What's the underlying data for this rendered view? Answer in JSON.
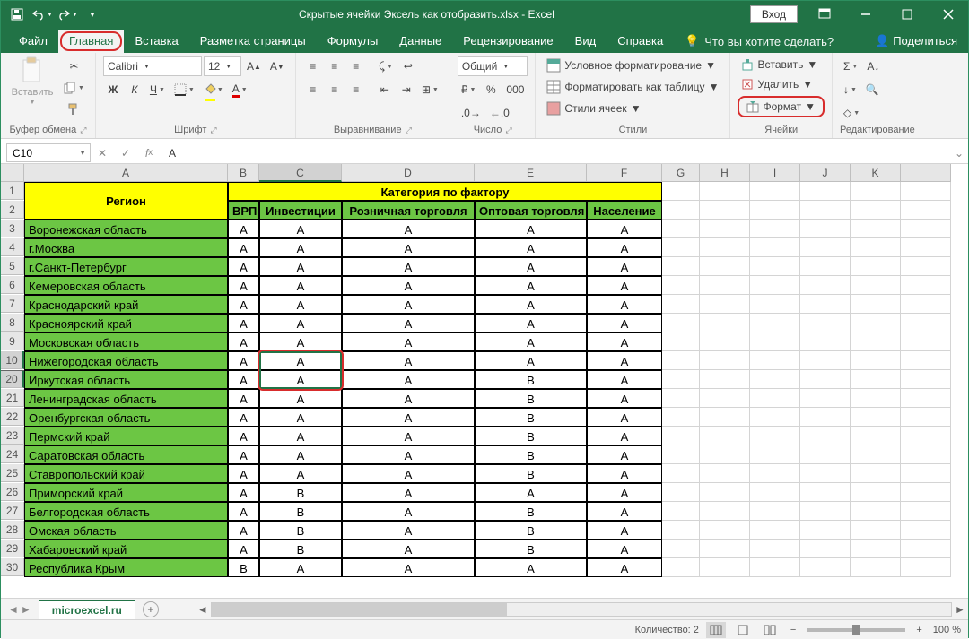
{
  "titlebar": {
    "title": "Скрытые ячейки Эксель как отобразить.xlsx  -  Excel",
    "signin": "Вход"
  },
  "tabs": [
    "Файл",
    "Главная",
    "Вставка",
    "Разметка страницы",
    "Формулы",
    "Данные",
    "Рецензирование",
    "Вид",
    "Справка"
  ],
  "active_tab": 1,
  "tell_me": "Что вы хотите сделать?",
  "share": "Поделиться",
  "ribbon": {
    "clipboard": {
      "paste": "Вставить",
      "label": "Буфер обмена"
    },
    "font": {
      "name": "Calibri",
      "size": "12",
      "label": "Шрифт"
    },
    "alignment": {
      "label": "Выравнивание"
    },
    "number": {
      "format": "Общий",
      "label": "Число"
    },
    "styles": {
      "cond": "Условное форматирование",
      "table": "Форматировать как таблицу",
      "cell": "Стили ячеек",
      "label": "Стили"
    },
    "cells": {
      "insert": "Вставить",
      "delete": "Удалить",
      "format": "Формат",
      "label": "Ячейки"
    },
    "editing": {
      "label": "Редактирование"
    }
  },
  "formula": {
    "name_box": "C10",
    "value": "А"
  },
  "columns": [
    "A",
    "B",
    "C",
    "D",
    "E",
    "F",
    "G",
    "H",
    "I",
    "J",
    "K"
  ],
  "header1": {
    "region": "Регион",
    "category": "Категория по фактору"
  },
  "header2": [
    "ВРП",
    "Инвестиции",
    "Розничная торговля",
    "Оптовая торговля",
    "Население"
  ],
  "rows": [
    {
      "n": 3,
      "region": "Воронежская область",
      "v": [
        "А",
        "А",
        "А",
        "А",
        "А"
      ]
    },
    {
      "n": 4,
      "region": "г.Москва",
      "v": [
        "А",
        "А",
        "А",
        "А",
        "А"
      ]
    },
    {
      "n": 5,
      "region": "г.Санкт-Петербург",
      "v": [
        "А",
        "А",
        "А",
        "А",
        "А"
      ]
    },
    {
      "n": 6,
      "region": "Кемеровская область",
      "v": [
        "А",
        "А",
        "А",
        "А",
        "А"
      ]
    },
    {
      "n": 7,
      "region": "Краснодарский край",
      "v": [
        "А",
        "А",
        "А",
        "А",
        "А"
      ]
    },
    {
      "n": 8,
      "region": "Красноярский край",
      "v": [
        "А",
        "А",
        "А",
        "А",
        "А"
      ]
    },
    {
      "n": 9,
      "region": "Московская область",
      "v": [
        "А",
        "А",
        "А",
        "А",
        "А"
      ]
    },
    {
      "n": 10,
      "region": "Нижегородская область",
      "v": [
        "А",
        "А",
        "А",
        "А",
        "А"
      ]
    },
    {
      "n": 20,
      "region": "Иркутская область",
      "v": [
        "А",
        "А",
        "А",
        "В",
        "А"
      ]
    },
    {
      "n": 21,
      "region": "Ленинградская область",
      "v": [
        "А",
        "А",
        "А",
        "В",
        "А"
      ]
    },
    {
      "n": 22,
      "region": "Оренбургская область",
      "v": [
        "А",
        "А",
        "А",
        "В",
        "А"
      ]
    },
    {
      "n": 23,
      "region": "Пермский край",
      "v": [
        "А",
        "А",
        "А",
        "В",
        "А"
      ]
    },
    {
      "n": 24,
      "region": "Саратовская область",
      "v": [
        "А",
        "А",
        "А",
        "В",
        "А"
      ]
    },
    {
      "n": 25,
      "region": "Ставропольский край",
      "v": [
        "А",
        "А",
        "А",
        "В",
        "А"
      ]
    },
    {
      "n": 26,
      "region": "Приморский край",
      "v": [
        "А",
        "В",
        "А",
        "А",
        "А"
      ]
    },
    {
      "n": 27,
      "region": "Белгородская область",
      "v": [
        "А",
        "В",
        "А",
        "В",
        "А"
      ]
    },
    {
      "n": 28,
      "region": "Омская область",
      "v": [
        "А",
        "В",
        "А",
        "В",
        "А"
      ]
    },
    {
      "n": 29,
      "region": "Хабаровский край",
      "v": [
        "А",
        "В",
        "А",
        "В",
        "А"
      ]
    },
    {
      "n": 30,
      "region": "Республика Крым",
      "v": [
        "В",
        "А",
        "А",
        "А",
        "А"
      ]
    }
  ],
  "sheet": {
    "name": "microexcel.ru"
  },
  "status": {
    "count": "Количество: 2",
    "zoom": "100 %"
  }
}
